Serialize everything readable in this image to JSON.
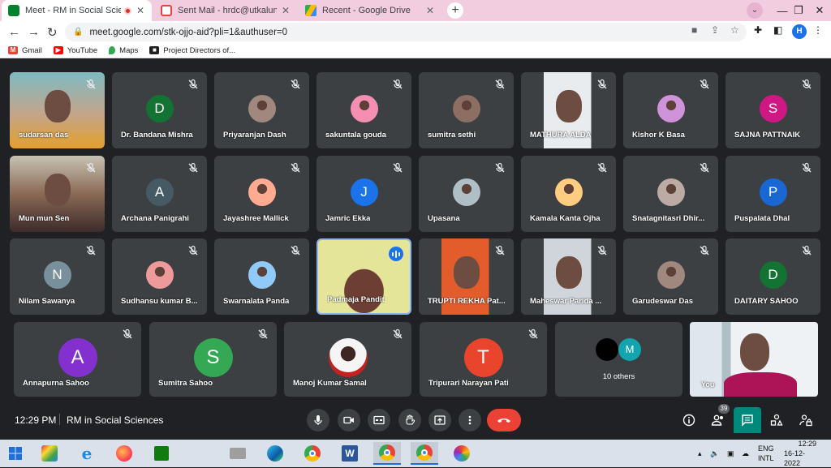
{
  "browser": {
    "tabs": [
      {
        "title": "Meet - RM in Social Sciences",
        "active": true
      },
      {
        "title": "Sent Mail - hrdc@utkaluniversity",
        "active": false
      },
      {
        "title": "Recent - Google Drive",
        "active": false
      }
    ],
    "url": "meet.google.com/stk-ojjo-aid?pli=1&authuser=0",
    "profile_initial": "H",
    "bookmarks": [
      "Gmail",
      "YouTube",
      "Maps",
      "Project Directors of..."
    ]
  },
  "participants": [
    {
      "name": "sudarsan das",
      "type": "video",
      "muted": true
    },
    {
      "name": "Dr. Bandana Mishra",
      "type": "initial",
      "initial": "D",
      "color": "#137333",
      "muted": true
    },
    {
      "name": "Priyaranjan Dash",
      "type": "photo",
      "muted": true
    },
    {
      "name": "sakuntala gouda",
      "type": "photo",
      "muted": true
    },
    {
      "name": "sumitra sethi",
      "type": "photo",
      "muted": true
    },
    {
      "name": "MATHURA ALDA",
      "type": "video",
      "muted": true
    },
    {
      "name": "Kishor K Basa",
      "type": "photo",
      "muted": true
    },
    {
      "name": "SAJNA PATTNAIK",
      "type": "initial",
      "initial": "S",
      "color": "#d01884",
      "muted": true
    },
    {
      "name": "Mun mun Sen",
      "type": "video",
      "muted": true
    },
    {
      "name": "Archana Panigrahi",
      "type": "initial",
      "initial": "A",
      "color": "#455a64",
      "muted": true
    },
    {
      "name": "Jayashree Mallick",
      "type": "photo",
      "muted": true
    },
    {
      "name": "Jamric Ekka",
      "type": "initial",
      "initial": "J",
      "color": "#1a73e8",
      "muted": true
    },
    {
      "name": "Upasana",
      "type": "photo",
      "muted": true
    },
    {
      "name": "Kamala Kanta Ojha",
      "type": "photo",
      "muted": true
    },
    {
      "name": "Snatagnitasri Dhir...",
      "type": "photo",
      "muted": true
    },
    {
      "name": "Puspalata Dhal",
      "type": "initial",
      "initial": "P",
      "color": "#1967d2",
      "muted": true
    },
    {
      "name": "Nilam Sawanya",
      "type": "initial",
      "initial": "N",
      "color": "#78909c",
      "muted": true
    },
    {
      "name": "Sudhansu kumar B...",
      "type": "photo",
      "muted": true
    },
    {
      "name": "Swarnalata Panda",
      "type": "photo",
      "muted": true
    },
    {
      "name": "Padmaja Pandit",
      "type": "video",
      "muted": false,
      "speaking": true
    },
    {
      "name": "TRUPTI REKHA Pat...",
      "type": "video",
      "muted": true
    },
    {
      "name": "Maheswar Parida ...",
      "type": "video",
      "muted": true
    },
    {
      "name": "Garudeswar Das",
      "type": "photo",
      "muted": true
    },
    {
      "name": "DAITARY SAHOO",
      "type": "initial",
      "initial": "D",
      "color": "#137333",
      "muted": true
    }
  ],
  "bottom_row": [
    {
      "name": "Annapurna Sahoo",
      "initial": "A",
      "color": "#8430ce",
      "muted": true
    },
    {
      "name": "Sumitra Sahoo",
      "initial": "S",
      "color": "#34a853",
      "muted": true
    },
    {
      "name": "Manoj Kumar Samal",
      "initial": "",
      "color": "#c5221f",
      "muted": true
    },
    {
      "name": "Tripurari Narayan Pati",
      "initial": "T",
      "color": "#e8452c",
      "muted": true
    }
  ],
  "others": {
    "label": "10 others",
    "initial": "M"
  },
  "self_label": "You",
  "meeting": {
    "time": "12:29 PM",
    "name": "RM in Social Sciences",
    "participant_count": "39"
  },
  "taskbar": {
    "lang": "ENG",
    "layout": "INTL",
    "time": "12:29",
    "date": "16-12-2022"
  }
}
